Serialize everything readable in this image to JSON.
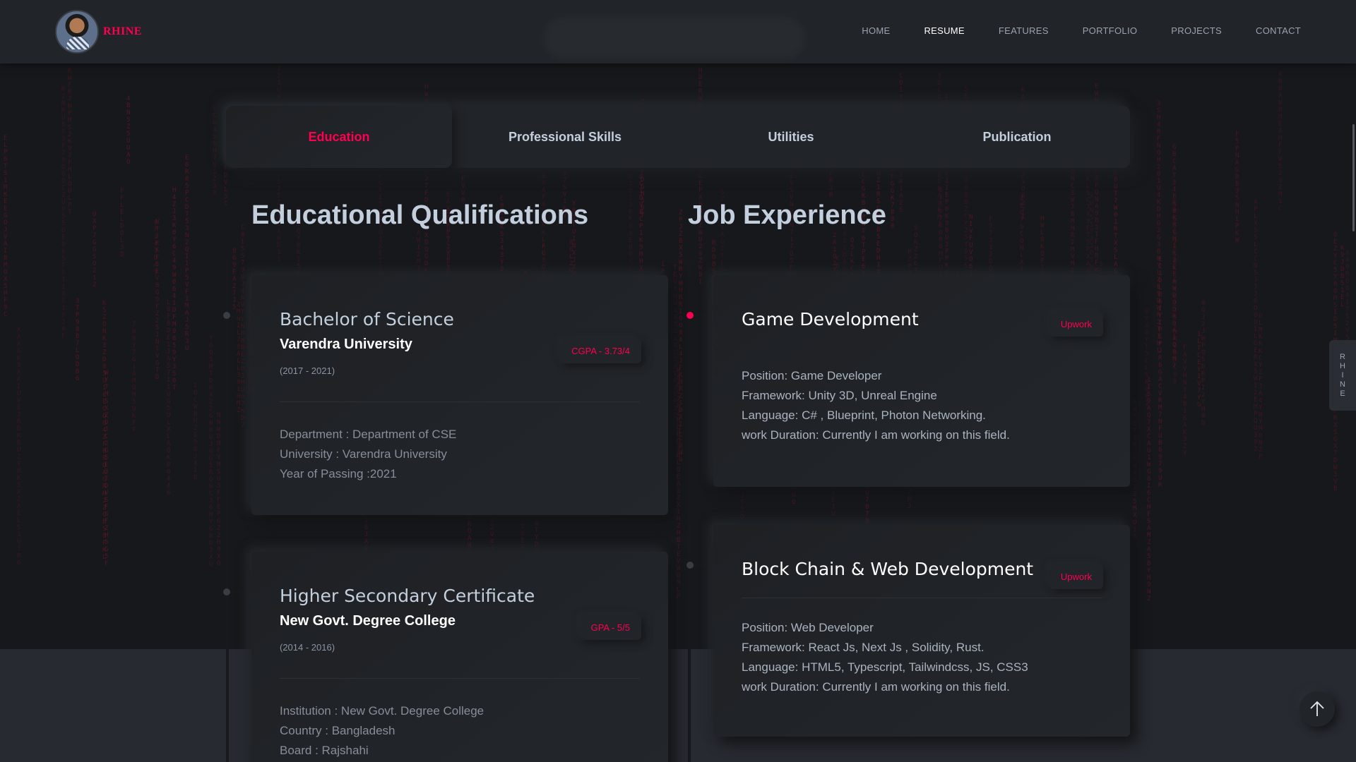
{
  "header": {
    "brand": "RHINE",
    "nav": [
      "HOME",
      "RESUME",
      "FEATURES",
      "PORTFOLIO",
      "PROJECTS",
      "CONTACT"
    ],
    "active_nav": "RESUME"
  },
  "tabs": [
    {
      "label": "Education",
      "active": true
    },
    {
      "label": "Professional Skills",
      "active": false
    },
    {
      "label": "Utilities",
      "active": false
    },
    {
      "label": "Publication",
      "active": false
    }
  ],
  "education": {
    "title": "Educational Qualifications",
    "items": [
      {
        "degree": "Bachelor of Science",
        "school": "Varendra University",
        "years": "(2017 - 2021)",
        "badge": "CGPA - 3.73/4",
        "lines": [
          "Department : Department of CSE",
          "University : Varendra University",
          "Year of Passing :2021"
        ]
      },
      {
        "degree": "Higher Secondary Certificate",
        "school": "New Govt. Degree College",
        "years": "(2014 - 2016)",
        "badge": "GPA - 5/5",
        "lines": [
          "Institution : New Govt. Degree College",
          "Country : Bangladesh",
          "Board : Rajshahi"
        ]
      }
    ]
  },
  "jobs": {
    "title": "Job Experience",
    "items": [
      {
        "title": "Game Development",
        "badge": "Upwork",
        "lines": [
          "Position: Game Developer",
          "Framework: Unity 3D, Unreal Engine",
          "Language: C# , Blueprint, Photon Networking.",
          "work Duration: Currently I am working on this field."
        ]
      },
      {
        "title": "Block Chain & Web Development",
        "badge": "Upwork",
        "lines": [
          "Position: Web Developer",
          "Framework: React Js, Next Js , Solidity, Rust.",
          "Language: HTML5, Typescript, Tailwindcss, JS, CSS3",
          "work Duration: Currently I am working on this field."
        ]
      }
    ]
  },
  "side_tab": [
    "R",
    "H",
    "I",
    "N",
    "E"
  ],
  "colors": {
    "accent": "#ff014f",
    "background": "#212428",
    "text": "#c4cfde"
  },
  "icons": {
    "back_to_top": "arrow-up-icon"
  }
}
